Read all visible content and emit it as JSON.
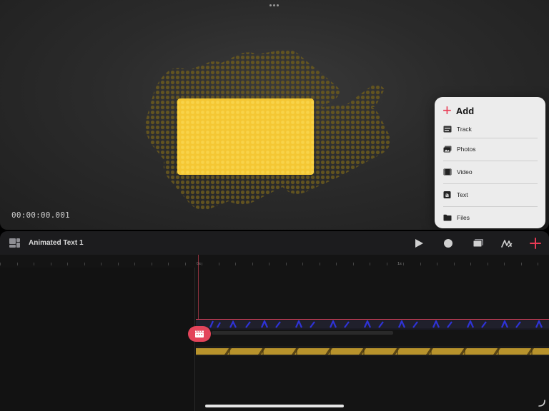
{
  "preview": {
    "timecode": "00:00:00.001",
    "canvas_fill": "#f5c935"
  },
  "add_menu": {
    "title": "Add",
    "items": [
      {
        "label": "Track",
        "icon": "track-icon"
      },
      {
        "label": "Photos",
        "icon": "photos-icon"
      },
      {
        "label": "Video",
        "icon": "video-icon"
      },
      {
        "label": "Text",
        "icon": "text-icon"
      },
      {
        "label": "Files",
        "icon": "folder-icon"
      }
    ]
  },
  "toolbar": {
    "project_title": "Animated Text 1",
    "buttons": [
      "play-icon",
      "record-icon",
      "layers-icon",
      "draw-icon",
      "add-icon"
    ]
  },
  "timeline": {
    "ruler_labels": [
      "0s",
      "1s"
    ],
    "accent": "#e3445a"
  },
  "colors": {
    "accent": "#e83a54",
    "dot_pattern": "#6b5a1e",
    "yellow": "#f5c935"
  }
}
